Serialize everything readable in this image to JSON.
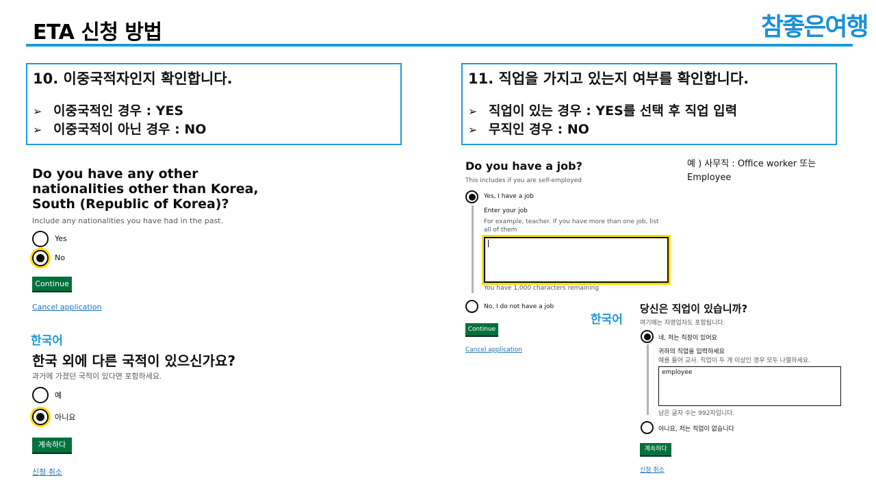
{
  "header": {
    "title": "ETA 신청 방법",
    "logo_text": "참좋은여행",
    "accent_color": "#1a9bd7"
  },
  "step10": {
    "heading": "10. 이중국적자인지 확인합니다.",
    "bullets": [
      "이중국적인 경우 : YES",
      "이중국적이 아닌 경우 : NO"
    ]
  },
  "step11": {
    "heading": "11. 직업을 가지고 있는지 여부를 확인합니다.",
    "bullets": [
      "직업이 있는 경우 : YES를 선택 후 직업 입력",
      "무직인 경우 : NO"
    ]
  },
  "bullet_icon": "➢",
  "nationality_en": {
    "question": "Do you have any other nationalities other than Korea, South (Republic of Korea)?",
    "hint": "Include any nationalities you have had in the past.",
    "option_yes": "Yes",
    "option_no": "No",
    "selected": "No",
    "continue": "Continue",
    "cancel": "Cancel application"
  },
  "nationality_ko": {
    "lang_label": "한국어",
    "question": "한국 외에 다른 국적이 있으신가요?",
    "hint": "과거에 가졌던 국적이 있다면 포함하세요.",
    "option_yes": "예",
    "option_no": "아니요",
    "selected": "아니요",
    "continue": "계속하다",
    "cancel": "신청 취소"
  },
  "job_en": {
    "question": "Do you have a job?",
    "hint": "This includes if you are self-employed",
    "option_yes": "Yes, I have a job",
    "selected": "Yes, I have a job",
    "enter_label": "Enter your job",
    "enter_hint": "For example, teacher. If you have more than one job, list all of them",
    "textarea_value": "",
    "remaining": "You have 1,000 characters remaining",
    "option_no": "No, I do not have a job",
    "continue": "Continue",
    "cancel": "Cancel application"
  },
  "example_note": "예 ) 사무직 : Office worker 또는 Employee",
  "job_ko": {
    "lang_label": "한국어",
    "question": "당신은 직업이 있습니까?",
    "hint": "여기에는 자영업자도 포함됩니다.",
    "option_yes": "네, 저는 직장이 있어요",
    "selected": "네, 저는 직장이 있어요",
    "enter_label": "귀하의 직업을 입력하세요",
    "enter_hint": "예를 들어 교사. 직업이 두 개 이상인 경우 모두 나열하세요.",
    "textarea_value": "employee",
    "remaining": "남은 글자 수는 992자입니다.",
    "option_no": "아니요, 저는 직업이 없습니다",
    "continue": "계속하다",
    "cancel": "신청 취소"
  }
}
